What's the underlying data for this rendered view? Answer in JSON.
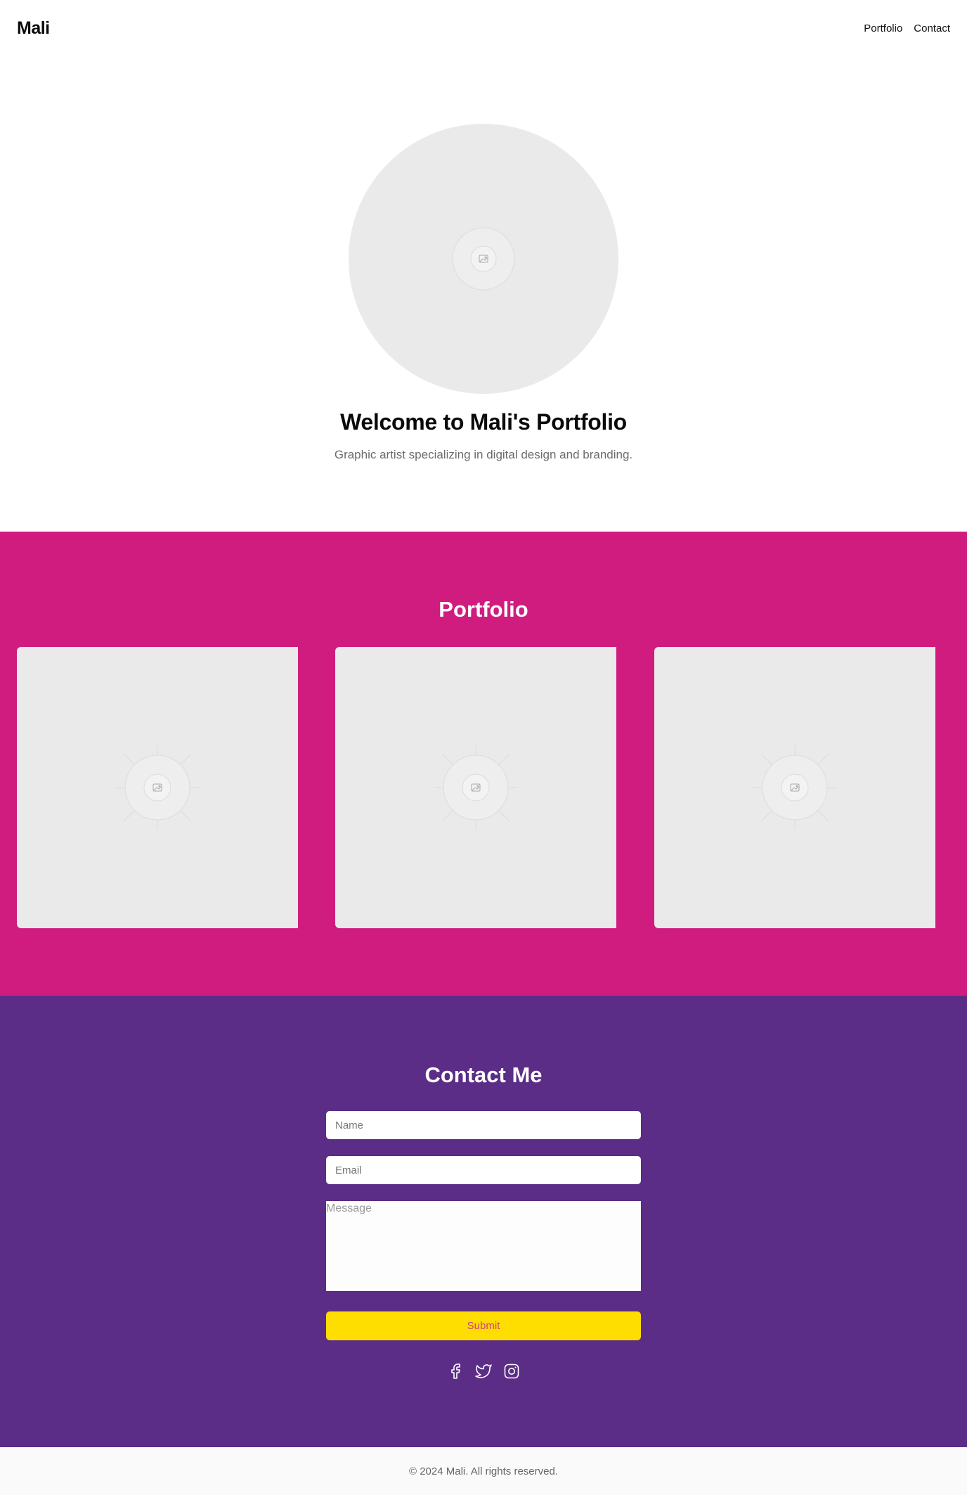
{
  "header": {
    "logo": "Mali",
    "nav": [
      {
        "label": "Portfolio"
      },
      {
        "label": "Contact"
      }
    ]
  },
  "hero": {
    "avatar_icon": "image-placeholder-icon",
    "title": "Welcome to Mali's Portfolio",
    "subtitle": "Graphic artist specializing in digital design and branding."
  },
  "portfolio": {
    "title": "Portfolio",
    "background": "#d01c7f",
    "items": [
      {
        "icon": "image-placeholder-icon"
      },
      {
        "icon": "image-placeholder-icon"
      },
      {
        "icon": "image-placeholder-icon"
      }
    ]
  },
  "contact": {
    "title": "Contact Me",
    "background": "#5b2d86",
    "name_placeholder": "Name",
    "email_placeholder": "Email",
    "message_placeholder": "Message",
    "submit_label": "Submit",
    "submit_color": "#fedd00",
    "socials": [
      {
        "icon": "facebook-icon"
      },
      {
        "icon": "twitter-icon"
      },
      {
        "icon": "instagram-icon"
      }
    ]
  },
  "footer": {
    "text": "© 2024 Mali. All rights reserved."
  }
}
